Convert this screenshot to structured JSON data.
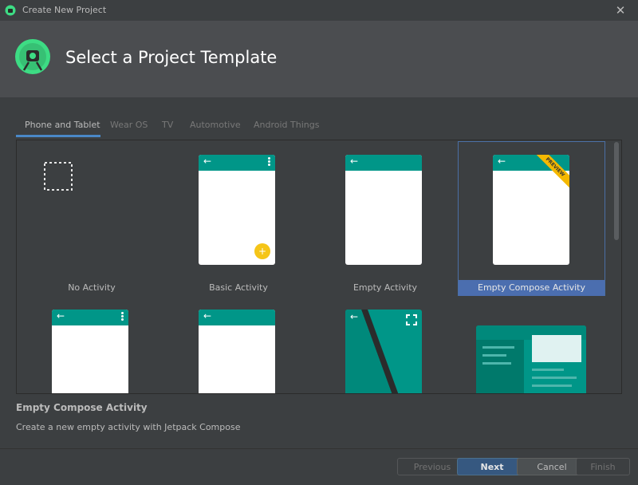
{
  "window": {
    "title": "Create New Project",
    "close_glyph": "✕"
  },
  "header": {
    "title": "Select a Project Template"
  },
  "tabs": [
    {
      "label": "Phone and Tablet",
      "active": true
    },
    {
      "label": "Wear OS"
    },
    {
      "label": "TV"
    },
    {
      "label": "Automotive"
    },
    {
      "label": "Android Things"
    }
  ],
  "templates": [
    {
      "label": "No Activity"
    },
    {
      "label": "Basic Activity"
    },
    {
      "label": "Empty Activity"
    },
    {
      "label": "Empty Compose Activity",
      "selected": true,
      "badge": "PREVIEW"
    }
  ],
  "glyphs": {
    "back": "←",
    "fab": "+"
  },
  "description": {
    "title": "Empty Compose Activity",
    "text": "Create a new empty activity with Jetpack Compose"
  },
  "buttons": {
    "previous": "Previous",
    "next": "Next",
    "cancel": "Cancel",
    "finish": "Finish"
  },
  "colors": {
    "accent": "#009688",
    "fab": "#f5c518",
    "selection": "#4b6eaf",
    "primary_button": "#365880"
  }
}
